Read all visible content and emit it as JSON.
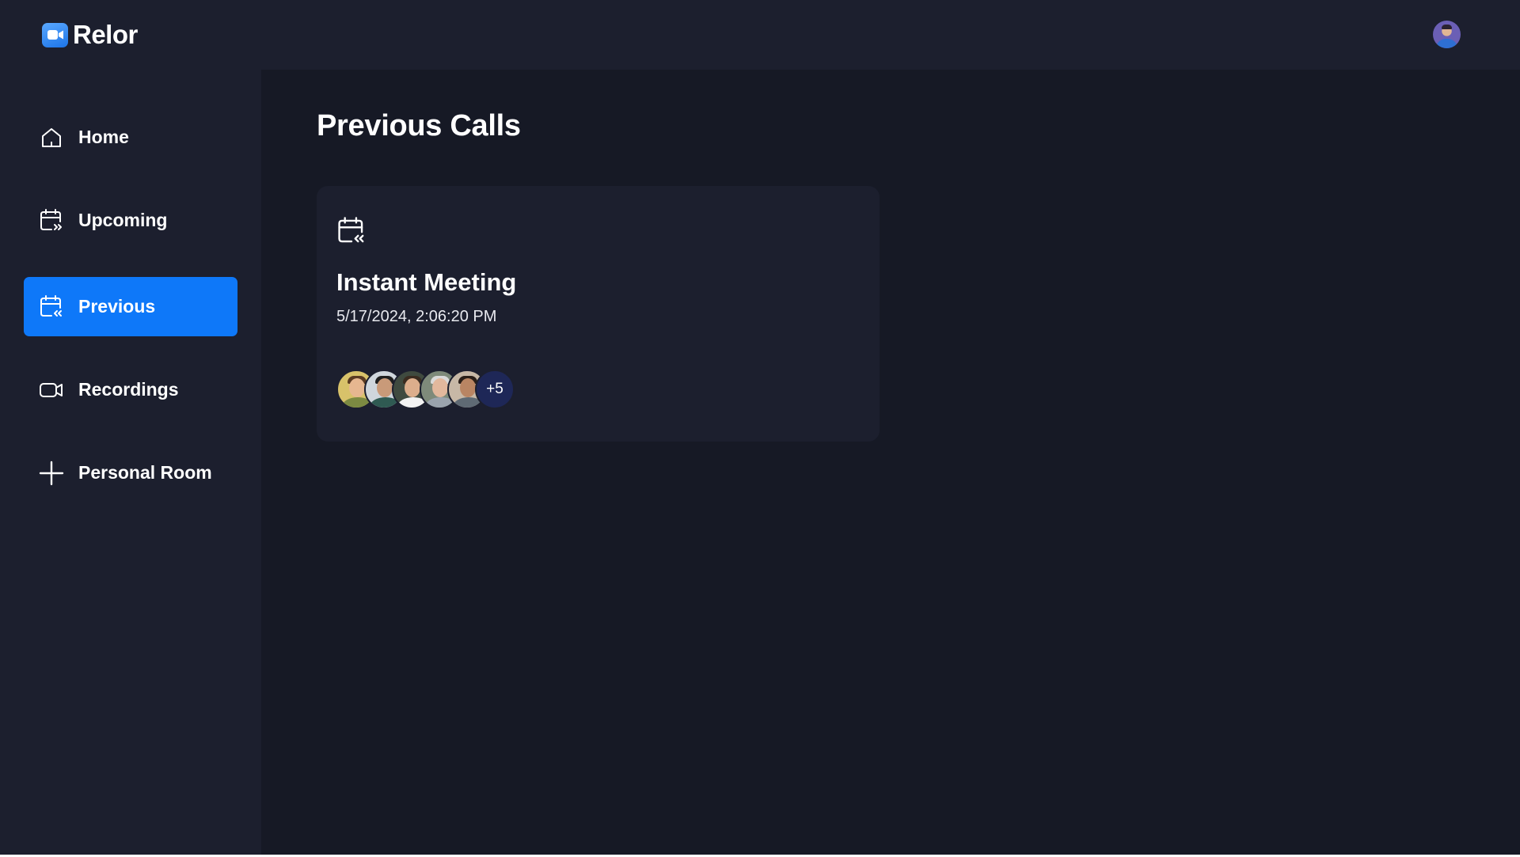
{
  "app": {
    "name": "Relor"
  },
  "sidebar": {
    "items": [
      {
        "label": "Home",
        "icon": "home-icon",
        "active": false
      },
      {
        "label": "Upcoming",
        "icon": "calendar-forward-icon",
        "active": false
      },
      {
        "label": "Previous",
        "icon": "calendar-back-icon",
        "active": true
      },
      {
        "label": "Recordings",
        "icon": "video-icon",
        "active": false
      },
      {
        "label": "Personal Room",
        "icon": "plus-icon",
        "active": false
      }
    ]
  },
  "main": {
    "title": "Previous Calls",
    "cards": [
      {
        "icon": "calendar-back-icon",
        "title": "Instant Meeting",
        "date": "5/17/2024, 2:06:20 PM",
        "extra_attendees": "+5"
      }
    ]
  },
  "colors": {
    "background": "#161925",
    "panel": "#1c1f2e",
    "accent": "#0e78f9",
    "more_badge": "#1e2757"
  }
}
